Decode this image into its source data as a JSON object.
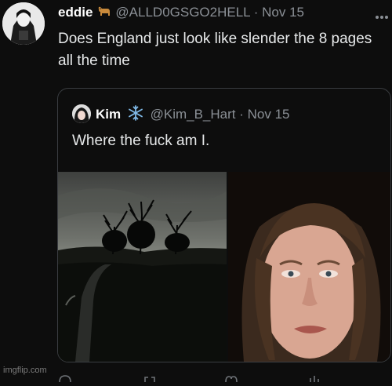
{
  "tweet": {
    "display_name": "eddie",
    "handle": "@ALLD0GSGO2HELL",
    "separator": "·",
    "date": "Nov 15",
    "text": "Does England just look like slender the 8 pages all the time",
    "name_emoji": "dog-icon"
  },
  "quoted_tweet": {
    "display_name": "Kim",
    "handle": "@Kim_B_Hart",
    "separator": "·",
    "date": "Nov 15",
    "text": "Where the fuck am I.",
    "name_emoji": "snowflake-icon",
    "media": [
      {
        "description_icon": "dark-landscape-photo"
      },
      {
        "description_icon": "selfie-photo"
      }
    ]
  },
  "watermark": "imgflip.com",
  "actions": [
    "reply-icon",
    "retweet-icon",
    "like-icon",
    "views-icon"
  ]
}
